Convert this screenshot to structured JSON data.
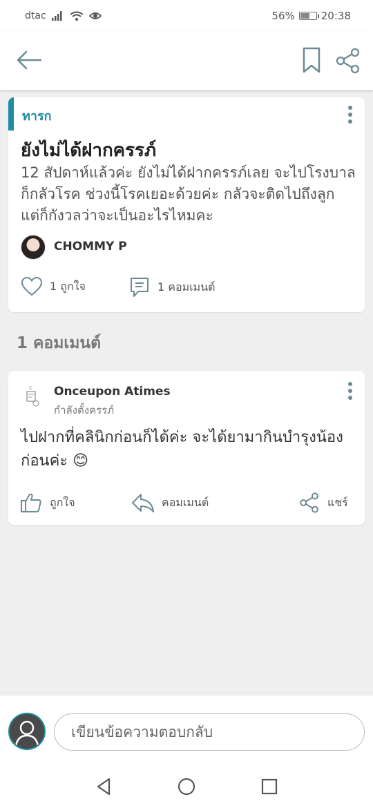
{
  "status_bar": {
    "carrier": "dtac",
    "battery": "56%",
    "battery_level": 0.56,
    "time": "20:38"
  },
  "post": {
    "category": "ทารก",
    "title": "ยังไม่ได้ฝากครรภ์",
    "body": "12 สัปดาห์แล้วค่ะ ยังไม่ได้ฝากครรภ์เลย จะไปโรงบาลก็กลัวโรค ช่วงนี้โรคเยอะด้วยค่ะ กลัวจะติดไปถึงลูก แต่ก็กังวลว่าจะเป็นอะไรไหมคะ",
    "author": "CHOMMY P",
    "likes": "1 ถูกใจ",
    "comments": "1 คอมเมนต์"
  },
  "comments_section": {
    "header": "1 คอมเมนต์"
  },
  "comment": {
    "author": "Onceupon Atimes",
    "status": "กำลังตั้งครรภ์",
    "text": "ไปฝากที่คลินิกก่อนก็ได้ค่ะ จะได้ยามากินบำรุงน้องก่อนค่ะ 😊",
    "like_label": "ถูกใจ",
    "comment_label": "คอมเมนต์",
    "share_label": "แชร์"
  },
  "reply": {
    "placeholder": "เขียนข้อความตอบกลับ"
  },
  "colors": {
    "accent": "#1f8ea0",
    "icon": "#6c8a94"
  }
}
